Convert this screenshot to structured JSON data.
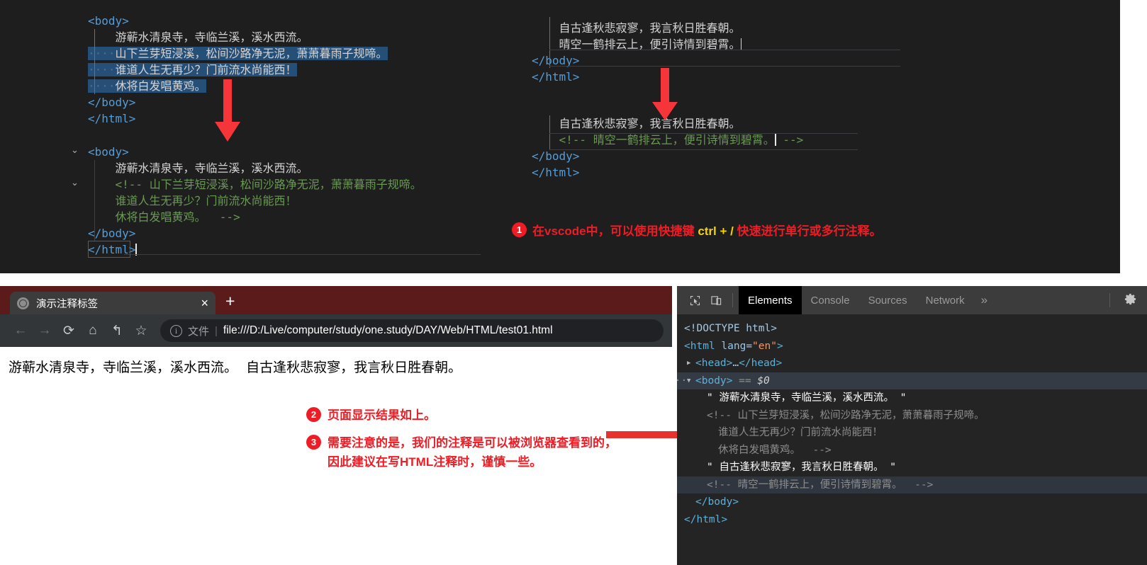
{
  "editor": {
    "top_left_block": {
      "lines": [
        {
          "segs": [
            {
              "t": "<body>",
              "c": "tag"
            }
          ]
        },
        {
          "segs": [
            {
              "t": "    游蕲水清泉寺，寺临兰溪，溪水西流。",
              "c": "txt"
            }
          ]
        },
        {
          "segs": [
            {
              "t": "····",
              "c": "dots"
            },
            {
              "t": "山下兰芽短浸溪，松间沙路净无泥，萧萧暮雨子规啼。",
              "c": "txt"
            }
          ]
        },
        {
          "segs": [
            {
              "t": "····",
              "c": "dots"
            },
            {
              "t": "谁道人生无再少？门前流水尚能西！",
              "c": "txt"
            }
          ]
        },
        {
          "segs": [
            {
              "t": "····",
              "c": "dots"
            },
            {
              "t": "休将白发唱黄鸡。",
              "c": "txt"
            }
          ]
        },
        {
          "segs": [
            {
              "t": "</body>",
              "c": "tag"
            }
          ]
        },
        {
          "segs": [
            {
              "t": "</html>",
              "c": "tag"
            }
          ]
        }
      ]
    },
    "bottom_left_block": {
      "lines": [
        {
          "segs": [
            {
              "t": "<body>",
              "c": "tag"
            }
          ]
        },
        {
          "segs": [
            {
              "t": "    游蕲水清泉寺，寺临兰溪，溪水西流。",
              "c": "txt"
            }
          ]
        },
        {
          "segs": [
            {
              "t": "    <!-- 山下兰芽短浸溪，松间沙路净无泥，萧萧暮雨子规啼。",
              "c": "comment"
            }
          ]
        },
        {
          "segs": [
            {
              "t": "    谁道人生无再少？门前流水尚能西！",
              "c": "comment"
            }
          ]
        },
        {
          "segs": [
            {
              "t": "    休将白发唱黄鸡。  -->",
              "c": "comment"
            }
          ]
        },
        {
          "segs": [
            {
              "t": "</body>",
              "c": "tag"
            }
          ]
        },
        {
          "segs": [
            {
              "t": "</html>",
              "c": "tag"
            }
          ]
        }
      ]
    },
    "top_right_block": {
      "lines": [
        {
          "segs": [
            {
              "t": "    自古逢秋悲寂寥，我言秋日胜春朝。",
              "c": "txt"
            }
          ]
        },
        {
          "segs": [
            {
              "t": "    晴空一鹤排云上，便引诗情到碧霄。",
              "c": "txt"
            }
          ]
        },
        {
          "segs": [
            {
              "t": "</body>",
              "c": "tag"
            }
          ]
        },
        {
          "segs": [
            {
              "t": "</html>",
              "c": "tag"
            }
          ]
        }
      ]
    },
    "bottom_right_block": {
      "lines": [
        {
          "segs": [
            {
              "t": "    自古逢秋悲寂寥，我言秋日胜春朝。",
              "c": "txt"
            }
          ]
        },
        {
          "segs": [
            {
              "t": "    <!-- 晴空一鹤排云上，便引诗情到碧霄。",
              "c": "comment"
            },
            {
              "t": " -->",
              "c": "comment"
            }
          ]
        },
        {
          "segs": [
            {
              "t": "</body>",
              "c": "tag"
            }
          ]
        },
        {
          "segs": [
            {
              "t": "</html>",
              "c": "tag"
            }
          ]
        }
      ]
    }
  },
  "annotations": {
    "note1": {
      "number": "1",
      "pre": "在vscode中，可以使用快捷键 ",
      "kbd": "ctrl + /",
      "post": " 快速进行单行或多行注释。"
    },
    "note2": {
      "number": "2",
      "text": "页面显示结果如上。"
    },
    "note3": {
      "number": "3",
      "line1": "需要注意的是，我们的注释是可以被浏览器查看到的，",
      "line2": "因此建议在写HTML注释时，谨慎一些。"
    }
  },
  "browser": {
    "tab_title": "演示注释标签",
    "tab_close_label": "×",
    "new_tab_label": "+",
    "nav": {
      "back": "←",
      "forward": "→",
      "reload": "⟳",
      "home": "⌂",
      "undo": "↰",
      "bookmark": "☆"
    },
    "omnibox": {
      "info_icon_label": "i",
      "scheme_label": "文件",
      "separator": "|",
      "url": "file:///D:/Live/computer/study/one.study/DAY/Web/HTML/test01.html"
    },
    "page_content": "游蕲水清泉寺，寺临兰溪，溪水西流。  自古逢秋悲寂寥，我言秋日胜春朝。"
  },
  "devtools": {
    "tabs": [
      {
        "label": "Elements",
        "active": true
      },
      {
        "label": "Console",
        "active": false
      },
      {
        "label": "Sources",
        "active": false
      },
      {
        "label": "Network",
        "active": false
      }
    ],
    "more_label": "»",
    "tree": [
      {
        "indent": 0,
        "segs": [
          {
            "t": "<!DOCTYPE html>",
            "c": "dt-punct"
          }
        ]
      },
      {
        "indent": 0,
        "segs": [
          {
            "t": "<html ",
            "c": "dt-tag"
          },
          {
            "t": "lang",
            "c": "dt-attr"
          },
          {
            "t": "=",
            "c": "dt-punct"
          },
          {
            "t": "\"en\"",
            "c": "dt-val"
          },
          {
            "t": ">",
            "c": "dt-tag"
          }
        ]
      },
      {
        "indent": 1,
        "triangle": "▶",
        "segs": [
          {
            "t": "<head>",
            "c": "dt-tag"
          },
          {
            "t": "…",
            "c": "dt-punct"
          },
          {
            "t": "</head>",
            "c": "dt-tag"
          }
        ]
      },
      {
        "indent": 1,
        "triangle": "▼",
        "dots": "···",
        "selected": true,
        "segs": [
          {
            "t": "<body>",
            "c": "dt-tag"
          },
          {
            "t": " == ",
            "c": "dt-eq"
          },
          {
            "t": "$0",
            "c": "dt-dollar"
          }
        ]
      },
      {
        "indent": 2,
        "segs": [
          {
            "t": "\" 游蕲水清泉寺，寺临兰溪，溪水西流。 \"",
            "c": "dt-text"
          }
        ]
      },
      {
        "indent": 2,
        "segs": [
          {
            "t": "<!-- 山下兰芽短浸溪，松间沙路净无泥，萧萧暮雨子规啼。",
            "c": "dt-comment"
          }
        ]
      },
      {
        "indent": 3,
        "segs": [
          {
            "t": "谁道人生无再少？门前流水尚能西！",
            "c": "dt-comment"
          }
        ]
      },
      {
        "indent": 3,
        "segs": [
          {
            "t": "休将白发唱黄鸡。  -->",
            "c": "dt-comment"
          }
        ]
      },
      {
        "indent": 2,
        "segs": [
          {
            "t": "\" 自古逢秋悲寂寥，我言秋日胜春朝。 \"",
            "c": "dt-text"
          }
        ]
      },
      {
        "indent": 2,
        "highlight": true,
        "segs": [
          {
            "t": "<!-- 晴空一鹤排云上，便引诗情到碧霄。  -->",
            "c": "dt-comment"
          }
        ]
      },
      {
        "indent": 1,
        "segs": [
          {
            "t": "</body>",
            "c": "dt-tag"
          }
        ]
      },
      {
        "indent": 0,
        "segs": [
          {
            "t": "</html>",
            "c": "dt-tag"
          }
        ]
      }
    ]
  },
  "colors": {
    "editor_bg": "#1e1e1e",
    "selection": "#264f78",
    "tag": "#569cd6",
    "comment": "#6a9955",
    "annotation_red": "#ee1c25",
    "annotation_yellow": "#f5d300",
    "browser_tabstrip": "#5c1b1b",
    "devtools_bg": "#242424"
  }
}
